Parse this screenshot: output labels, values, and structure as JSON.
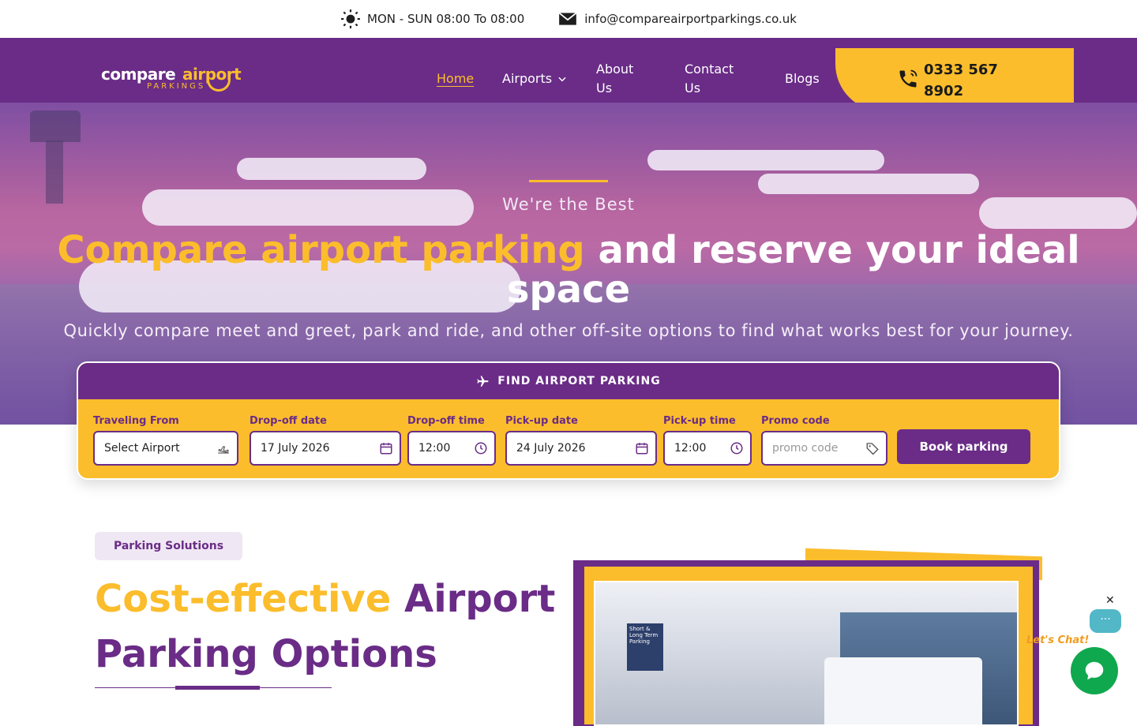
{
  "topbar": {
    "hours": "MON - SUN 08:00 To 08:00",
    "email": "info@compareairportparkings.co.uk"
  },
  "brand": {
    "word1": "compare",
    "word2": "airport",
    "sub": "PARKINGS",
    "primary_color": "#6a2c87",
    "accent_color": "#fbbd2c"
  },
  "nav": {
    "home": "Home",
    "airports": "Airports",
    "about": "About Us",
    "contact": "Contact Us",
    "blogs": "Blogs"
  },
  "phone": {
    "number": "0333 567 8902",
    "icon": "phone-icon"
  },
  "hero": {
    "tagline": "We're the Best",
    "headline_highlight": "Compare airport parking",
    "headline_rest": " and reserve your ideal space",
    "subtext": "Quickly compare meet and greet, park and ride, and other off-site options to find what works best for your journey."
  },
  "search": {
    "header": "FIND AIRPORT PARKING",
    "fields": {
      "traveling_from": {
        "label": "Traveling From",
        "value": "Select Airport"
      },
      "dropoff_date": {
        "label": "Drop-off date",
        "value": "17 July 2026"
      },
      "dropoff_time": {
        "label": "Drop-off time",
        "value": "12:00"
      },
      "pickup_date": {
        "label": "Pick-up date",
        "value": "24 July 2026"
      },
      "pickup_time": {
        "label": "Pick-up time",
        "value": "12:00"
      },
      "promo": {
        "label": "Promo code",
        "placeholder": "promo code"
      }
    },
    "button": "Book parking"
  },
  "section": {
    "badge": "Parking Solutions",
    "title_highlight": "Cost-effective",
    "title_rest": " Airport Parking Options"
  },
  "photo": {
    "sign_text": "Short & Long Term Parking"
  },
  "chat": {
    "label": "Let's Chat!",
    "close": "✕",
    "dots": "···"
  }
}
